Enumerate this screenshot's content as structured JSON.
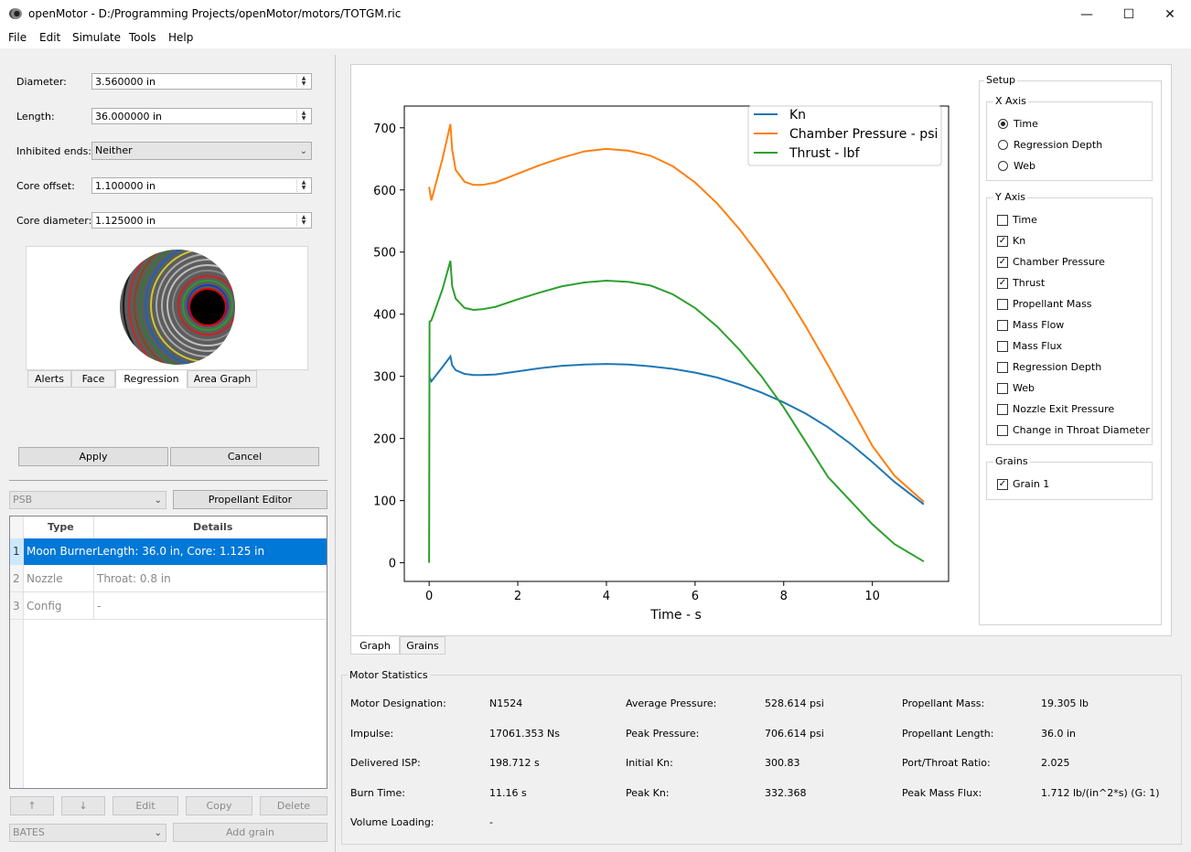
{
  "window": {
    "title": "openMotor - D:/Programming Projects/openMotor/motors/TOTGM.ric",
    "minimize": "—",
    "maximize": "☐",
    "close": "✕"
  },
  "menu": [
    "File",
    "Edit",
    "Simulate",
    "Tools",
    "Help"
  ],
  "grain_editor": {
    "fields": [
      {
        "label": "Diameter:",
        "value": "3.560000 in"
      },
      {
        "label": "Length:",
        "value": "36.000000 in"
      },
      {
        "label": "Inhibited ends:",
        "value": "Neither"
      },
      {
        "label": "Core offset:",
        "value": "1.100000 in"
      },
      {
        "label": "Core diameter:",
        "value": "1.125000 in"
      }
    ],
    "tabs": [
      "Alerts",
      "Face",
      "Regression",
      "Area Graph"
    ],
    "apply": "Apply",
    "cancel": "Cancel"
  },
  "propellant": {
    "selected": "PSB",
    "editor_button": "Propellant Editor"
  },
  "grain_table": {
    "headers": [
      "Type",
      "Details"
    ],
    "rows": [
      {
        "num": "1",
        "type": "Moon Burner",
        "details": "Length: 36.0 in, Core: 1.125 in"
      },
      {
        "num": "2",
        "type": "Nozzle",
        "details": "Throat: 0.8 in"
      },
      {
        "num": "3",
        "type": "Config",
        "details": "-"
      }
    ]
  },
  "grain_buttons": {
    "up": "↑",
    "down": "↓",
    "edit": "Edit",
    "copy": "Copy",
    "delete": "Delete"
  },
  "add_grain": {
    "type": "BATES",
    "button": "Add grain"
  },
  "plot_tabs": [
    "Graph",
    "Grains"
  ],
  "setup": {
    "title": "Setup",
    "x_axis": {
      "title": "X Axis",
      "options": [
        "Time",
        "Regression Depth",
        "Web"
      ],
      "selected": "Time"
    },
    "y_axis": {
      "title": "Y Axis",
      "options": [
        {
          "label": "Time",
          "checked": false
        },
        {
          "label": "Kn",
          "checked": true
        },
        {
          "label": "Chamber Pressure",
          "checked": true
        },
        {
          "label": "Thrust",
          "checked": true
        },
        {
          "label": "Propellant Mass",
          "checked": false
        },
        {
          "label": "Mass Flow",
          "checked": false
        },
        {
          "label": "Mass Flux",
          "checked": false
        },
        {
          "label": "Regression Depth",
          "checked": false
        },
        {
          "label": "Web",
          "checked": false
        },
        {
          "label": "Nozzle Exit Pressure",
          "checked": false
        },
        {
          "label": "Change in Throat Diameter",
          "checked": false
        }
      ]
    },
    "grains": {
      "title": "Grains",
      "options": [
        {
          "label": "Grain 1",
          "checked": true
        }
      ]
    }
  },
  "chart_data": {
    "type": "line",
    "xlabel": "Time - s",
    "ylabel": "",
    "xlim": [
      -0.56,
      11.72
    ],
    "ylim": [
      -30,
      735
    ],
    "xticks": [
      0,
      2,
      4,
      6,
      8,
      10
    ],
    "yticks": [
      0,
      100,
      200,
      300,
      400,
      500,
      600,
      700
    ],
    "legend_position": "top-right",
    "series": [
      {
        "name": "Kn",
        "color": "#1f77b4",
        "x": [
          0,
          0.05,
          0.3,
          0.48,
          0.52,
          0.6,
          0.8,
          1.0,
          1.2,
          1.5,
          2.0,
          2.5,
          3.0,
          3.5,
          4.0,
          4.5,
          5.0,
          5.5,
          6.0,
          6.5,
          7.0,
          7.5,
          8.0,
          8.5,
          9.0,
          9.5,
          10.0,
          10.5,
          11.16
        ],
        "y": [
          300,
          292,
          315,
          332,
          318,
          310,
          304,
          302,
          302,
          303,
          308,
          313,
          317,
          319,
          320,
          319,
          316,
          312,
          306,
          298,
          287,
          274,
          258,
          240,
          218,
          192,
          162,
          130,
          94
        ]
      },
      {
        "name": "Chamber Pressure - psi",
        "color": "#ff7f0e",
        "x": [
          0,
          0.05,
          0.3,
          0.48,
          0.52,
          0.6,
          0.8,
          1.0,
          1.2,
          1.5,
          2.0,
          2.5,
          3.0,
          3.5,
          4.0,
          4.5,
          5.0,
          5.5,
          6.0,
          6.5,
          7.0,
          7.5,
          8.0,
          8.5,
          9.0,
          9.5,
          10.0,
          10.5,
          11.16
        ],
        "y": [
          605,
          583,
          650,
          706,
          665,
          632,
          613,
          608,
          608,
          612,
          626,
          640,
          652,
          662,
          666,
          663,
          655,
          638,
          612,
          578,
          537,
          490,
          438,
          380,
          318,
          253,
          188,
          140,
          98
        ]
      },
      {
        "name": "Thrust - lbf",
        "color": "#2ca02c",
        "x": [
          0,
          0.01,
          0.05,
          0.3,
          0.48,
          0.52,
          0.6,
          0.8,
          1.0,
          1.2,
          1.5,
          2.0,
          2.5,
          3.0,
          3.5,
          4.0,
          4.5,
          5.0,
          5.5,
          6.0,
          6.5,
          7.0,
          7.5,
          8.0,
          8.5,
          9.0,
          9.5,
          10.0,
          10.5,
          11.16
        ],
        "y": [
          0,
          388,
          390,
          440,
          486,
          445,
          425,
          410,
          407,
          408,
          412,
          424,
          435,
          445,
          451,
          454,
          452,
          446,
          432,
          410,
          380,
          343,
          300,
          250,
          194,
          138,
          100,
          62,
          30,
          2
        ]
      }
    ]
  },
  "statistics": {
    "title": "Motor Statistics",
    "col1": [
      {
        "label": "Motor Designation:",
        "value": "N1524"
      },
      {
        "label": "Impulse:",
        "value": "17061.353 Ns"
      },
      {
        "label": "Delivered ISP:",
        "value": "198.712 s"
      },
      {
        "label": "Burn Time:",
        "value": "11.16 s"
      },
      {
        "label": "Volume Loading:",
        "value": "-"
      }
    ],
    "col2": [
      {
        "label": "Average Pressure:",
        "value": "528.614 psi"
      },
      {
        "label": "Peak Pressure:",
        "value": "706.614 psi"
      },
      {
        "label": "Initial Kn:",
        "value": "300.83"
      },
      {
        "label": "Peak Kn:",
        "value": "332.368"
      }
    ],
    "col3": [
      {
        "label": "Propellant Mass:",
        "value": "19.305 lb"
      },
      {
        "label": "Propellant Length:",
        "value": "36.0 in"
      },
      {
        "label": "Port/Throat Ratio:",
        "value": "2.025"
      },
      {
        "label": "Peak Mass Flux:",
        "value": "1.712 lb/(in^2*s) (G: 1)"
      }
    ]
  }
}
